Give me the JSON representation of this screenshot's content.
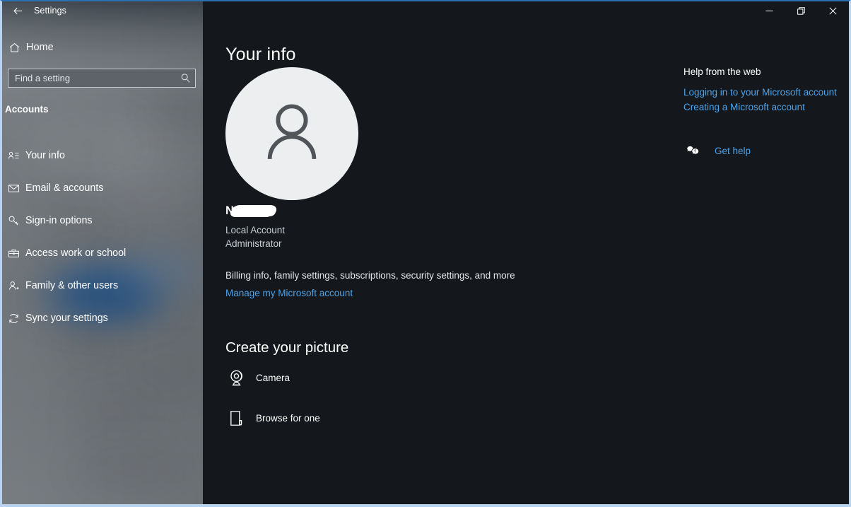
{
  "window": {
    "title": "Settings",
    "back_icon": "back-arrow-icon",
    "controls": {
      "minimize": "minimize-icon",
      "restore": "restore-icon",
      "close": "close-icon"
    }
  },
  "sidebar": {
    "home_label": "Home",
    "home_icon": "home-icon",
    "search": {
      "placeholder": "Find a setting",
      "value": "Find a setting",
      "icon": "search-icon"
    },
    "section_title": "Accounts",
    "items": [
      {
        "label": "Your info",
        "icon": "user-details-icon"
      },
      {
        "label": "Email & accounts",
        "icon": "envelope-icon"
      },
      {
        "label": "Sign-in options",
        "icon": "key-icon"
      },
      {
        "label": "Access work or school",
        "icon": "briefcase-icon"
      },
      {
        "label": "Family & other users",
        "icon": "user-add-icon"
      },
      {
        "label": "Sync your settings",
        "icon": "sync-icon"
      }
    ]
  },
  "main": {
    "page_title": "Your info",
    "avatar_icon": "person-avatar-icon",
    "account": {
      "name_prefix": "N",
      "name_redacted": true,
      "account_type": "Local Account",
      "role": "Administrator"
    },
    "billing_text": "Billing info, family settings, subscriptions, security settings, and more",
    "manage_link": "Manage my Microsoft account",
    "create_picture": {
      "heading": "Create your picture",
      "options": [
        {
          "label": "Camera",
          "icon": "camera-icon"
        },
        {
          "label": "Browse for one",
          "icon": "browse-file-icon"
        }
      ]
    }
  },
  "help_panel": {
    "title": "Help from the web",
    "links": [
      "Logging in to your Microsoft account",
      "Creating a Microsoft account"
    ],
    "get_help": {
      "label": "Get help",
      "icon": "help-chat-icon"
    }
  },
  "colors": {
    "accent_link": "#4da2e8",
    "window_border": "#b9d2ef",
    "main_background": "#14181c",
    "sidebar_background": "#6d7277",
    "avatar_background": "#eceef0"
  }
}
